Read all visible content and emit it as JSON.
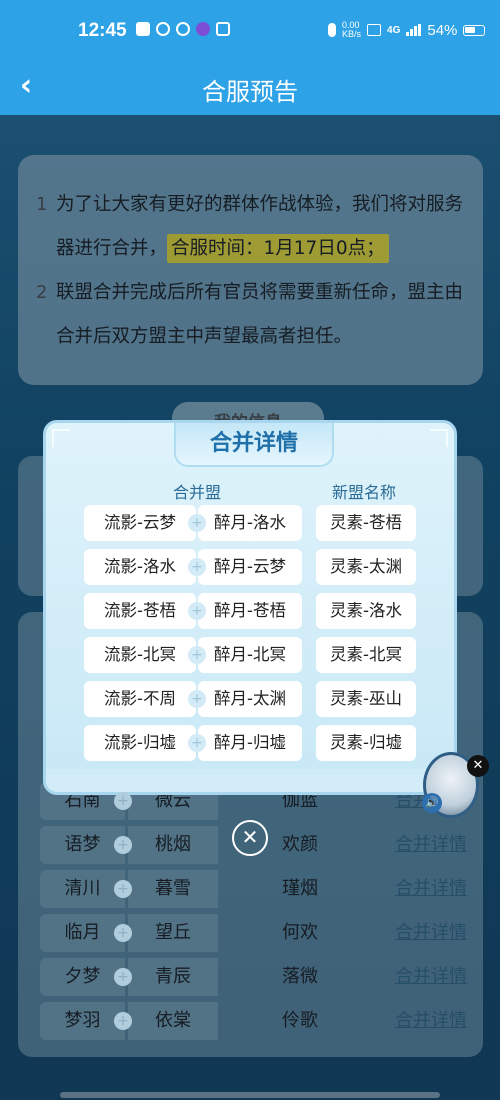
{
  "status_bar": {
    "time": "12:45",
    "net_speed_value": "0.00",
    "net_speed_unit": "KB/s",
    "net_badge": "4G",
    "battery": "54%"
  },
  "header": {
    "back_icon": "‹",
    "title": "合服预告"
  },
  "notice": {
    "items": [
      {
        "num": "1",
        "text_before": "为了让大家有更好的群体作战体验，我们将对服务器进行合并，",
        "highlight": "合服时间：1月17日0点；"
      },
      {
        "num": "2",
        "text": "联盟合并完成后所有官员将需要重新任命，盟主由合并后双方盟主中声望最高者担任。"
      }
    ]
  },
  "background_list": {
    "tab_label": "我的信息",
    "rows": [
      {
        "a": "石南",
        "b": "微云",
        "c": "伽蓝",
        "link": "合并详情"
      },
      {
        "a": "语梦",
        "b": "桃烟",
        "c": "欢颜",
        "link": "合并详情"
      },
      {
        "a": "清川",
        "b": "暮雪",
        "c": "瑾烟",
        "link": "合并详情"
      },
      {
        "a": "临月",
        "b": "望丘",
        "c": "何欢",
        "link": "合并详情"
      },
      {
        "a": "夕梦",
        "b": "青辰",
        "c": "落微",
        "link": "合并详情"
      },
      {
        "a": "梦羽",
        "b": "依棠",
        "c": "伶歌",
        "link": "合并详情"
      }
    ]
  },
  "modal": {
    "title": "合并详情",
    "col_merge": "合并盟",
    "col_new": "新盟名称",
    "rows": [
      {
        "a": "流影-云梦",
        "b": "醉月-洛水",
        "new": "灵素-苍梧"
      },
      {
        "a": "流影-洛水",
        "b": "醉月-云梦",
        "new": "灵素-太渊"
      },
      {
        "a": "流影-苍梧",
        "b": "醉月-苍梧",
        "new": "灵素-洛水"
      },
      {
        "a": "流影-北冥",
        "b": "醉月-北冥",
        "new": "灵素-北冥"
      },
      {
        "a": "流影-不周",
        "b": "醉月-太渊",
        "new": "灵素-巫山"
      },
      {
        "a": "流影-归墟",
        "b": "醉月-归墟",
        "new": "灵素-归墟"
      }
    ],
    "plus_glyph": "+",
    "close_glyph": "✕"
  },
  "floating_widget": {
    "close_glyph": "✕",
    "speaker_glyph": "🔊"
  },
  "colors": {
    "accent": "#2ea2e6",
    "highlight": "#f3e23b",
    "link": "#3a6d8b"
  }
}
